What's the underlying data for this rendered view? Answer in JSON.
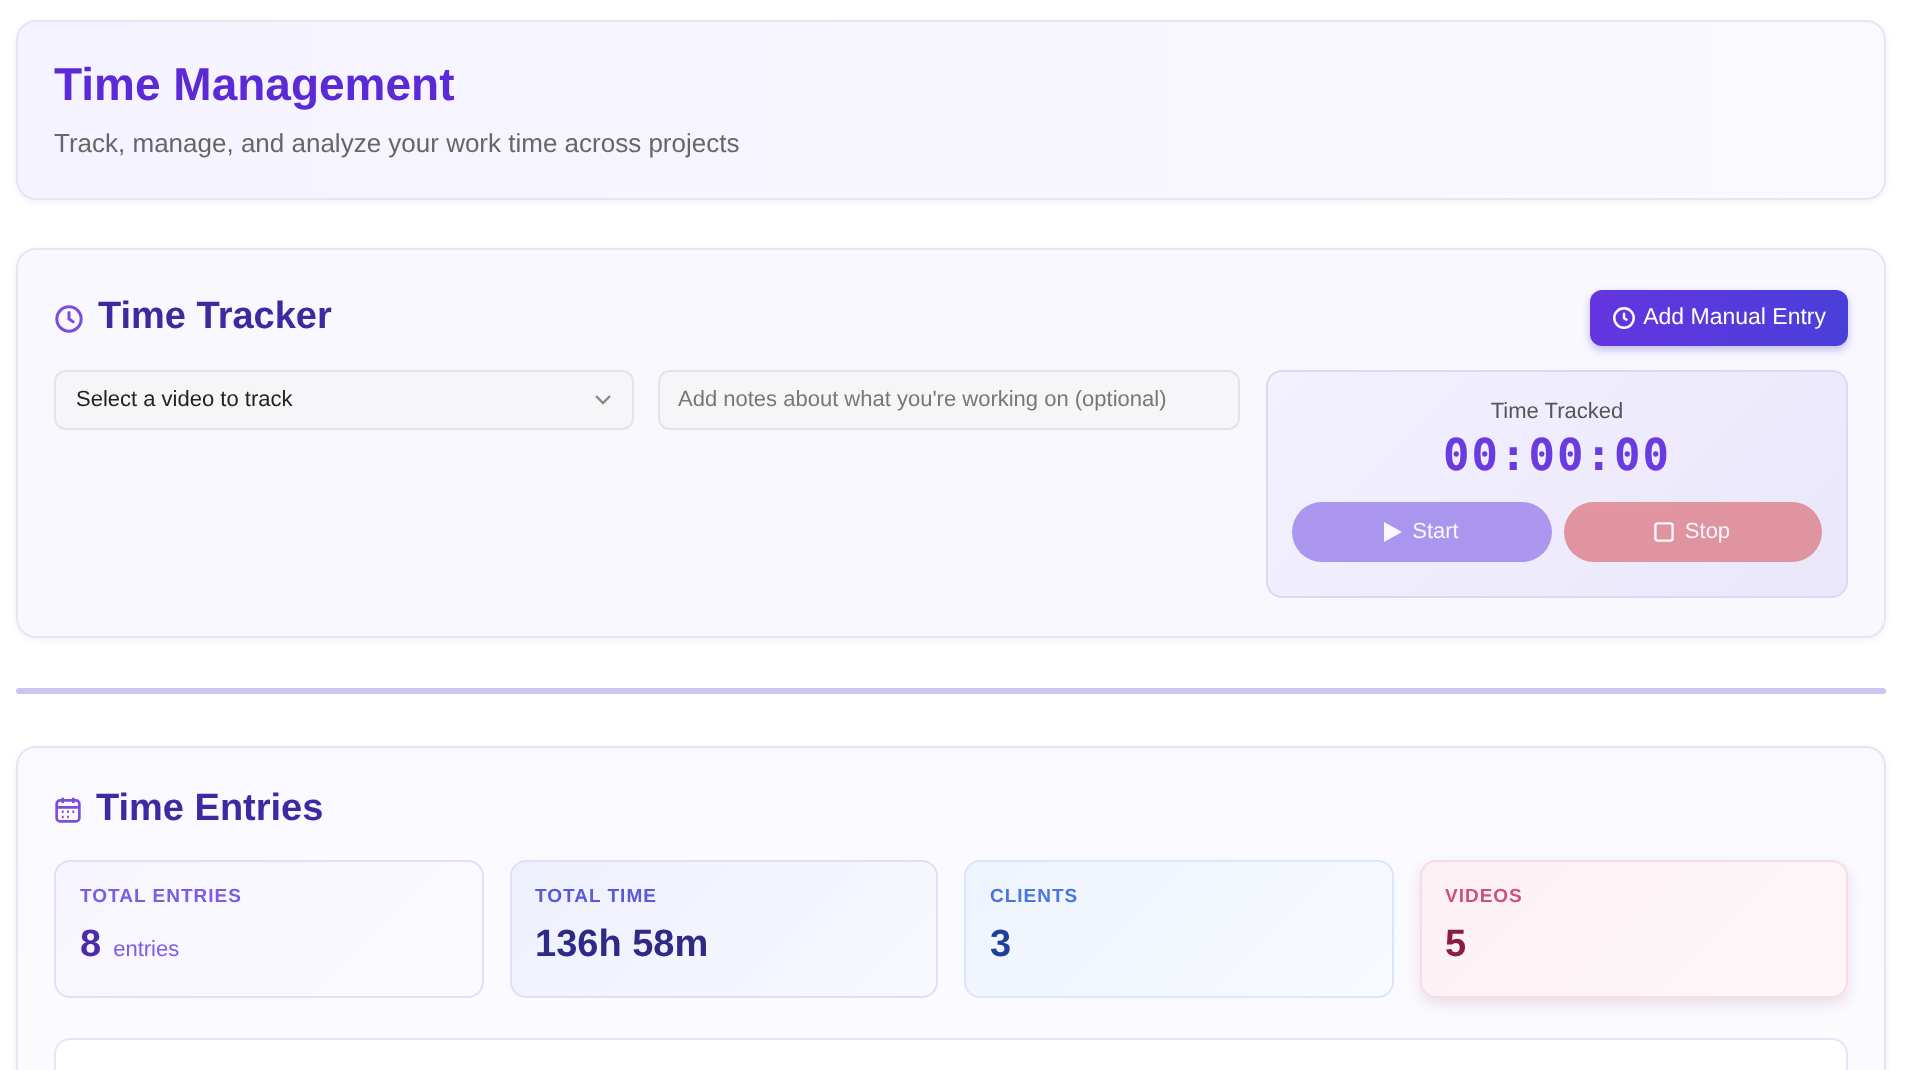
{
  "header": {
    "title": "Time Management",
    "subtitle": "Track, manage, and analyze your work time across projects"
  },
  "tracker": {
    "title": "Time Tracker",
    "add_button": "Add Manual Entry",
    "video_select": {
      "value": "Select a video to track"
    },
    "notes": {
      "placeholder": "Add notes about what you're working on (optional)"
    },
    "timer": {
      "label": "Time Tracked",
      "value": "00:00:00",
      "buttons": [
        {
          "kind": "start",
          "label": "Start",
          "disabled": true
        },
        {
          "kind": "stop",
          "label": "Stop",
          "disabled": true
        }
      ]
    }
  },
  "entries": {
    "title": "Time Entries",
    "stats": [
      {
        "kind": "entries",
        "label": "TOTAL ENTRIES",
        "value": "8",
        "unit": "entries"
      },
      {
        "kind": "time",
        "label": "TOTAL TIME",
        "value": "136h 58m"
      },
      {
        "kind": "clients",
        "label": "CLIENTS",
        "value": "3"
      },
      {
        "kind": "videos",
        "label": "VIDEOS",
        "value": "5"
      }
    ]
  }
}
